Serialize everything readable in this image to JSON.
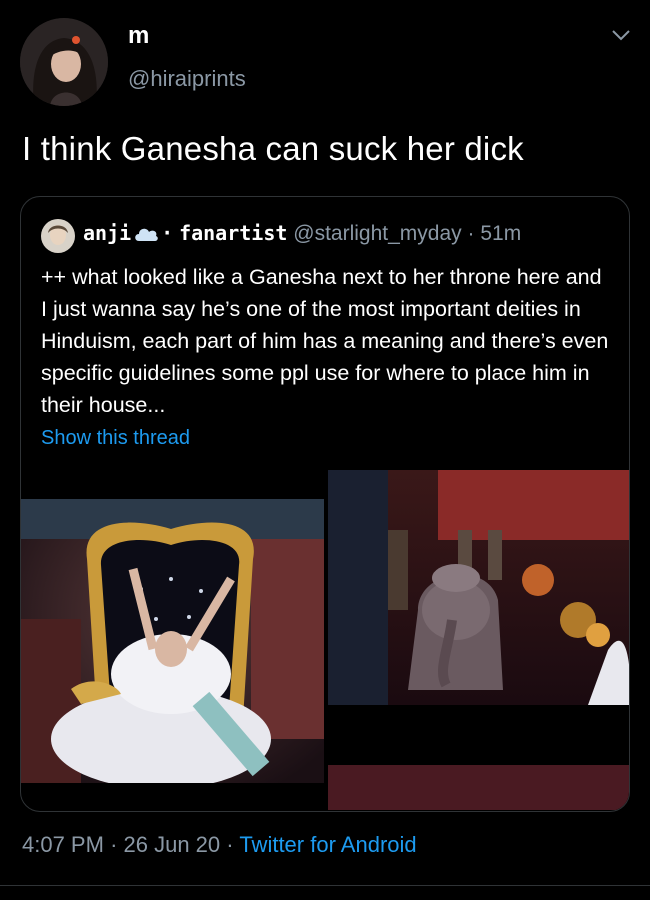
{
  "author": {
    "display_name": "m",
    "handle": "@hiraiprints"
  },
  "tweet": {
    "text": "I think Ganesha can suck her dick",
    "time": "4:07 PM",
    "date": "26 Jun 20",
    "source": "Twitter for Android"
  },
  "quoted": {
    "name_part1": "anji",
    "name_part2": "fanartist",
    "handle": "@starlight_myday",
    "age": "51m",
    "body": "++ what looked like a Ganesha next to her throne here and I just wanna say he’s one of the most important deities in Hinduism, each part of him has a meaning and there’s even specific guidelines some ppl use for where to place him in their house...",
    "show_thread": "Show this thread"
  },
  "icons": {
    "chevron": "chevron-down-icon",
    "cloud": "cloud-icon"
  },
  "colors": {
    "background": "#000000",
    "link": "#1d9bf0",
    "muted": "#8b98a5",
    "border": "#2f3336"
  }
}
